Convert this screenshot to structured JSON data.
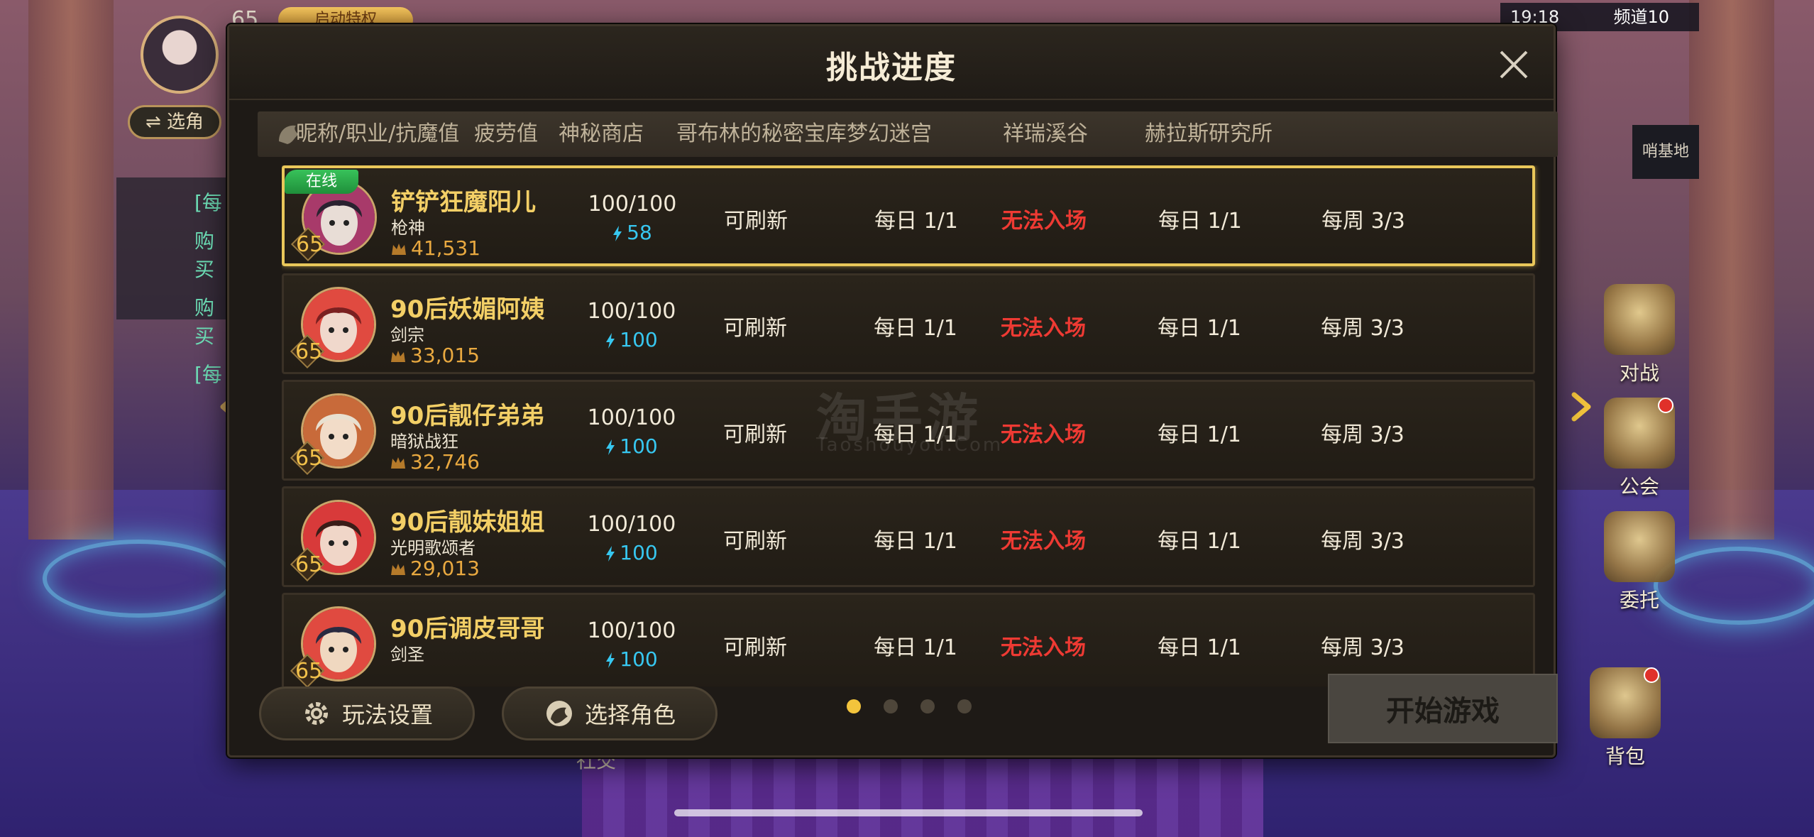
{
  "hud": {
    "level": "65",
    "privilege_label": "启动特权",
    "switch_role_label": "⇌ 选角",
    "chat_prefix": "[每",
    "chat_line_1": "购买",
    "chat_line_2": "购买",
    "chat_prefix_2": "[每",
    "status_time": "19:18",
    "status_channel": "频道10",
    "base_label": "哨基地",
    "side_buttons": [
      "对战",
      "公会",
      "委托",
      "背包"
    ],
    "social_label": "社交"
  },
  "modal": {
    "title": "挑战进度",
    "columns": [
      "昵称/职业/抗魔值",
      "疲劳值",
      "神秘商店",
      "哥布林的秘密宝库",
      "梦幻迷宫",
      "祥瑞溪谷",
      "赫拉斯研究所"
    ],
    "online_badge": "在线",
    "characters": [
      {
        "level": "65",
        "name": "铲铲狂魔阳儿",
        "job": "枪神",
        "power": "41,531",
        "fatigue": "100/100",
        "energy": "58",
        "shop": "可刷新",
        "goblin": "每日 1/1",
        "maze": "无法入场",
        "valley": "每日 1/1",
        "lab": "每周 3/3",
        "online": true
      },
      {
        "level": "65",
        "name": "90后妖媚阿姨",
        "job": "剑宗",
        "power": "33,015",
        "fatigue": "100/100",
        "energy": "100",
        "shop": "可刷新",
        "goblin": "每日 1/1",
        "maze": "无法入场",
        "valley": "每日 1/1",
        "lab": "每周 3/3",
        "online": false
      },
      {
        "level": "65",
        "name": "90后靓仔弟弟",
        "job": "暗狱战狂",
        "power": "32,746",
        "fatigue": "100/100",
        "energy": "100",
        "shop": "可刷新",
        "goblin": "每日 1/1",
        "maze": "无法入场",
        "valley": "每日 1/1",
        "lab": "每周 3/3",
        "online": false
      },
      {
        "level": "65",
        "name": "90后靓妹姐姐",
        "job": "光明歌颂者",
        "power": "29,013",
        "fatigue": "100/100",
        "energy": "100",
        "shop": "可刷新",
        "goblin": "每日 1/1",
        "maze": "无法入场",
        "valley": "每日 1/1",
        "lab": "每周 3/3",
        "online": false
      },
      {
        "level": "65",
        "name": "90后调皮哥哥",
        "job": "剑圣",
        "power": "",
        "fatigue": "100/100",
        "energy": "100",
        "shop": "可刷新",
        "goblin": "每日 1/1",
        "maze": "无法入场",
        "valley": "每日 1/1",
        "lab": "每周 3/3",
        "online": false
      }
    ],
    "footer": {
      "settings_label": "玩法设置",
      "select_role_label": "选择角色",
      "start_label": "开始游戏",
      "page_count": 4,
      "active_page": 1
    }
  },
  "watermark": {
    "text": "淘手游",
    "sub": "Taoshouyou.Com"
  },
  "colors": {
    "accent_gold": "#f3cf66",
    "selected_border": "#e9c75a",
    "online_green": "#2fb04c",
    "error_red": "#ee3a33",
    "energy_cyan": "#37c7f0"
  }
}
